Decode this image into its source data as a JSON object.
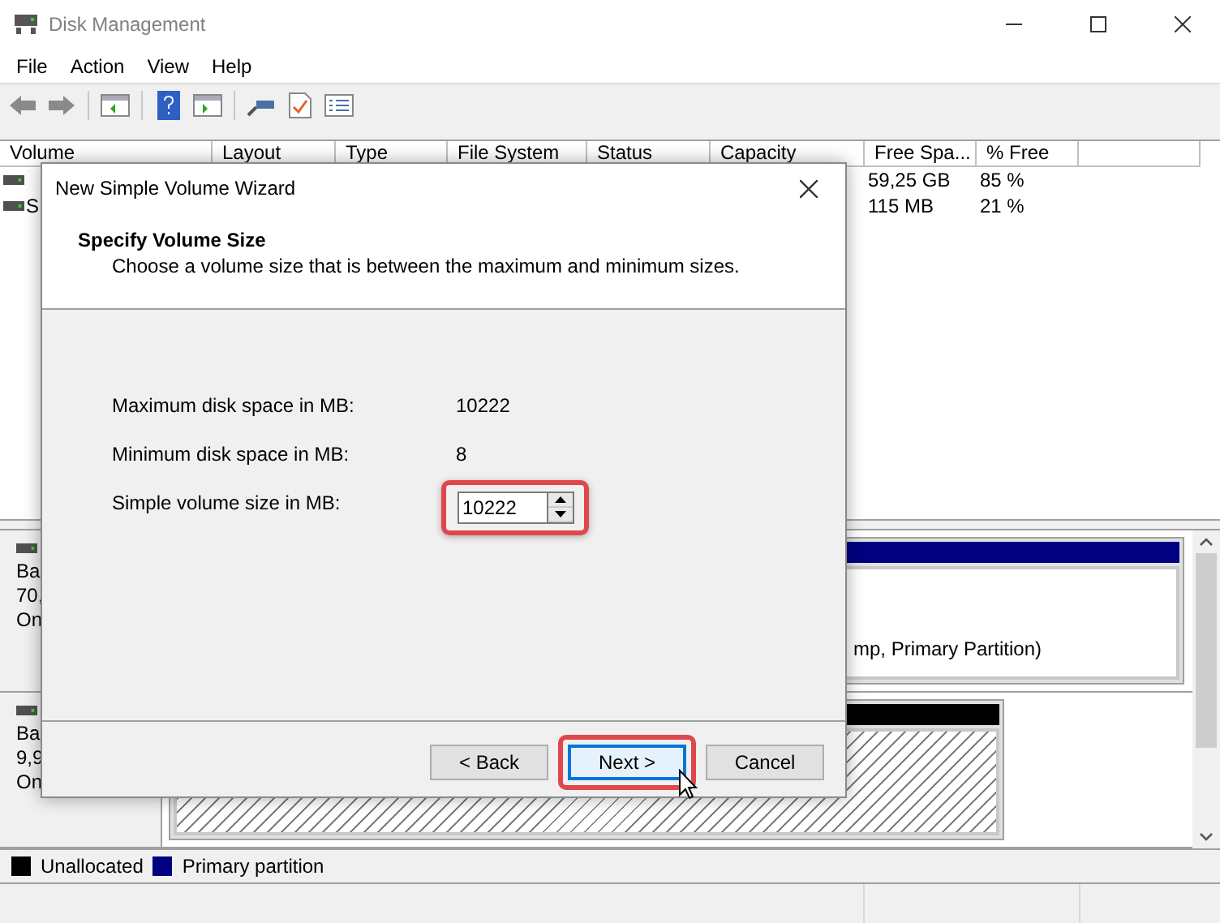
{
  "window": {
    "title": "Disk Management"
  },
  "menu": [
    "File",
    "Action",
    "View",
    "Help"
  ],
  "volume_table": {
    "columns": [
      "Volume",
      "Layout",
      "Type",
      "File System",
      "Status",
      "Capacity",
      "Free Spa...",
      "% Free",
      ""
    ],
    "rows": [
      {
        "volume": "",
        "free_space": "59,25 GB",
        "pct_free": "85 %"
      },
      {
        "volume": "S",
        "free_space": "115 MB",
        "pct_free": "21 %"
      }
    ]
  },
  "disks": [
    {
      "info": [
        "Ba",
        "70,",
        "On"
      ],
      "partition": {
        "kind": "primary",
        "text": "mp, Primary Partition)"
      }
    },
    {
      "info": [
        "Ba",
        "9,9",
        "On"
      ],
      "partition": {
        "kind": "unallocated"
      }
    }
  ],
  "legend": [
    {
      "label": "Unallocated",
      "color": "#000000"
    },
    {
      "label": "Primary partition",
      "color": "#000080"
    }
  ],
  "dialog": {
    "title": "New Simple Volume Wizard",
    "heading": "Specify Volume Size",
    "subtitle": "Choose a volume size that is between the maximum and minimum sizes.",
    "fields": [
      {
        "label": "Maximum disk space in MB:",
        "value": "10222"
      },
      {
        "label": "Minimum disk space in MB:",
        "value": "8"
      }
    ],
    "spin": {
      "label": "Simple volume size in MB:",
      "value": "10222",
      "highlighted": true
    },
    "buttons": [
      {
        "label": "< Back",
        "default": false,
        "highlighted": false
      },
      {
        "label": "Next >",
        "default": true,
        "highlighted": true
      },
      {
        "label": "Cancel",
        "default": false,
        "highlighted": false
      }
    ]
  }
}
